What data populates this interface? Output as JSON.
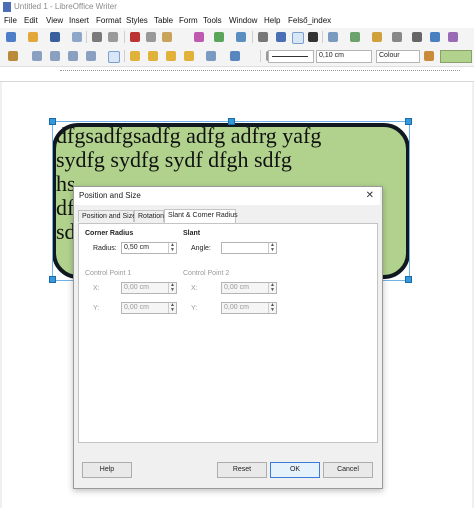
{
  "window": {
    "title": "Untitled 1 - LibreOffice Writer"
  },
  "menu": [
    "File",
    "Edit",
    "View",
    "Insert",
    "Format",
    "Styles",
    "Table",
    "Form",
    "Tools",
    "Window",
    "Help",
    "Felső_index"
  ],
  "toolbar2": {
    "line_width": "0,10 cm",
    "area_style": "Colour"
  },
  "document": {
    "shape_text": [
      "dfgsadfgsadfg adfg adfrg yafg",
      "sydfg sydfg sydf dfgh sdfg",
      "hs",
      "df",
      "sd"
    ],
    "shape_fill": "#b1d28c",
    "shape_border": "#101820"
  },
  "dialog": {
    "title": "Position and Size",
    "close_icon": "close-icon",
    "tabs": [
      "Position and Size",
      "Rotation",
      "Slant & Corner Radius"
    ],
    "corner_radius": {
      "heading": "Corner Radius",
      "radius_label": "Radius:",
      "radius_value": "0,50 cm"
    },
    "slant": {
      "heading": "Slant",
      "angle_label": "Angle:",
      "angle_value": ""
    },
    "control_point_1": {
      "heading": "Control Point 1",
      "x_label": "X:",
      "x_value": "0,00 cm",
      "y_label": "Y:",
      "y_value": "0,00 cm"
    },
    "control_point_2": {
      "heading": "Control Point 2",
      "x_label": "X:",
      "x_value": "0,00 cm",
      "y_label": "Y:",
      "y_value": "0,00 cm"
    },
    "buttons": {
      "help": "Help",
      "reset": "Reset",
      "ok": "OK",
      "cancel": "Cancel"
    }
  }
}
